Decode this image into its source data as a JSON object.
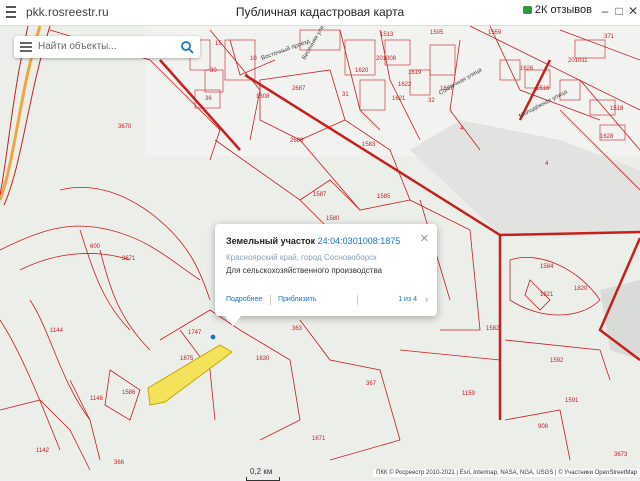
{
  "browser": {
    "url": "pkk.rosreestr.ru",
    "title": "Публичная кадастровая карта",
    "reviews": "2К отзывов"
  },
  "search": {
    "placeholder": "Найти объекты..."
  },
  "popup": {
    "type_label": "Земельный участок",
    "cad_number": "24:04:0301008:1875",
    "address": "Красноярский край, город Сосновоборск",
    "land_use": "Для сельскохозяйственного производства",
    "more_link": "Подробнее",
    "zoom_link": "Приблизить",
    "pager": "1 из 4"
  },
  "parcel_labels": [
    "15",
    "10",
    "2687",
    "3670",
    "2688",
    "1583",
    "1587",
    "1580",
    "1585",
    "1584",
    "1821",
    "1820",
    "1592",
    "1747",
    "1875",
    "363",
    "367",
    "1159",
    "908",
    "1591",
    "1630",
    "1671",
    "1144",
    "1142",
    "366",
    "1146",
    "600",
    "3671",
    "1586",
    "4",
    "4",
    "32",
    "1513",
    "201008",
    "201011",
    "31",
    "1622",
    "1621",
    "1620",
    "30",
    "36",
    "1608",
    "1619",
    "1627",
    "1626",
    "1516",
    "1518",
    "1559",
    "1628",
    "371",
    "1582",
    "3673",
    "1505"
  ],
  "streets": [
    "Весенняя улица",
    "Солнечная улица",
    "Молодёжная улица",
    "Восточный проезд"
  ],
  "map": {
    "scale_label": "0,2 км",
    "attribution": "ПКК © Росреестр 2010-2021 | Esri, Intermap, NASA, NGA, USGS | © Участники OpenStreetMap"
  },
  "colors": {
    "parcel_border": "#c81e1e",
    "selected_parcel": "#f3e25a",
    "link": "#1a73c6"
  }
}
